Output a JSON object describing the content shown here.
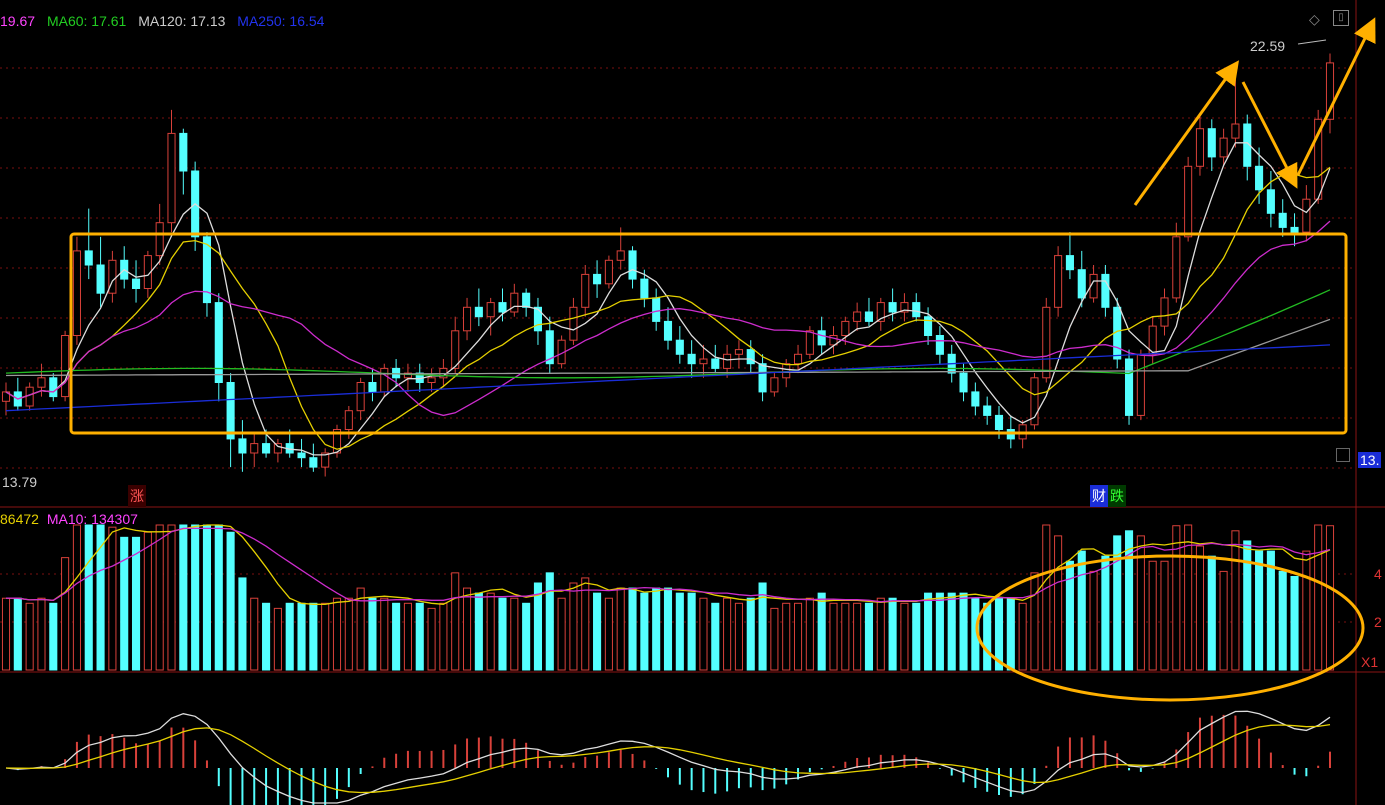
{
  "colors": {
    "up": "#d9413a",
    "down": "#54ffff",
    "white_line": "#dddddd",
    "yellow_line": "#e5d000",
    "magenta_line": "#cc2ccc",
    "green_line": "#22bb22",
    "gray_line": "#9a9a9a",
    "blue_line": "#1a2dd8",
    "grid": "#7a1010",
    "annotation": "#ffb000"
  },
  "price_header": {
    "items": [
      {
        "label": "19.67",
        "color": "#ff44ff"
      },
      {
        "label": "MA60: 17.61",
        "color": "#22cc22"
      },
      {
        "label": "MA120: 17.13",
        "color": "#cccccc"
      },
      {
        "label": "MA250: 16.54",
        "color": "#2233ee"
      }
    ]
  },
  "volume_header": {
    "items": [
      {
        "label": "86472",
        "color": "#e5d000"
      },
      {
        "label": "MA10: 134307",
        "color": "#ff44ff"
      }
    ]
  },
  "labels": {
    "low_price": "13.79",
    "high_price": "22.59",
    "marker_zhang": "涨",
    "marker_cai": "财",
    "marker_die": "跌",
    "right_price_tag": "13.",
    "vol_axis_4": "4",
    "vol_axis_2": "2",
    "vol_unit": "X1"
  },
  "icons": [
    "diamond-icon",
    "window-icon"
  ],
  "chart_data": [
    {
      "type": "candlestick",
      "description_source": "price panel",
      "ylim": [
        13.3,
        23.3
      ],
      "visible_values": {
        "high": 22.59,
        "low": 13.79
      },
      "series": [
        {
          "name": "MA60",
          "value_last": 17.61
        },
        {
          "name": "MA120",
          "value_last": 17.13
        },
        {
          "name": "MA250",
          "value_last": 16.54
        }
      ],
      "candles": [
        [
          15.4,
          15.8,
          15.1,
          15.6
        ],
        [
          15.6,
          15.9,
          15.2,
          15.3
        ],
        [
          15.3,
          15.8,
          15.2,
          15.7
        ],
        [
          15.7,
          16.2,
          15.5,
          15.9
        ],
        [
          15.9,
          16.0,
          15.4,
          15.5
        ],
        [
          15.5,
          16.9,
          15.4,
          16.8
        ],
        [
          16.8,
          18.9,
          16.6,
          18.6
        ],
        [
          18.6,
          19.5,
          18.0,
          18.3
        ],
        [
          18.3,
          18.9,
          17.4,
          17.7
        ],
        [
          17.7,
          18.6,
          17.5,
          18.4
        ],
        [
          18.4,
          18.7,
          17.8,
          18.0
        ],
        [
          18.0,
          18.4,
          17.5,
          17.8
        ],
        [
          17.8,
          18.6,
          17.6,
          18.5
        ],
        [
          18.5,
          19.6,
          18.3,
          19.2
        ],
        [
          19.2,
          21.6,
          19.0,
          21.1
        ],
        [
          21.1,
          21.2,
          19.8,
          20.3
        ],
        [
          20.3,
          20.5,
          18.6,
          18.9
        ],
        [
          18.9,
          19.0,
          17.2,
          17.5
        ],
        [
          17.5,
          17.7,
          15.4,
          15.8
        ],
        [
          15.8,
          16.0,
          14.0,
          14.6
        ],
        [
          14.6,
          15.0,
          13.9,
          14.3
        ],
        [
          14.3,
          14.7,
          14.0,
          14.5
        ],
        [
          14.5,
          14.8,
          14.2,
          14.3
        ],
        [
          14.3,
          14.6,
          14.1,
          14.5
        ],
        [
          14.5,
          14.8,
          14.2,
          14.3
        ],
        [
          14.3,
          14.6,
          14.0,
          14.2
        ],
        [
          14.2,
          14.5,
          13.9,
          14.0
        ],
        [
          14.0,
          14.4,
          13.8,
          14.3
        ],
        [
          14.3,
          14.9,
          14.2,
          14.8
        ],
        [
          14.8,
          15.3,
          14.6,
          15.2
        ],
        [
          15.2,
          15.9,
          15.0,
          15.8
        ],
        [
          15.8,
          16.1,
          15.4,
          15.6
        ],
        [
          15.6,
          16.2,
          15.5,
          16.1
        ],
        [
          16.1,
          16.3,
          15.7,
          15.9
        ],
        [
          15.9,
          16.2,
          15.6,
          16.0
        ],
        [
          16.0,
          16.2,
          15.6,
          15.8
        ],
        [
          15.8,
          16.1,
          15.6,
          15.9
        ],
        [
          15.9,
          16.3,
          15.7,
          16.1
        ],
        [
          16.1,
          17.2,
          16.0,
          16.9
        ],
        [
          16.9,
          17.6,
          16.7,
          17.4
        ],
        [
          17.4,
          17.8,
          17.0,
          17.2
        ],
        [
          17.2,
          17.6,
          16.8,
          17.5
        ],
        [
          17.5,
          17.8,
          17.1,
          17.3
        ],
        [
          17.3,
          17.9,
          17.2,
          17.7
        ],
        [
          17.7,
          17.8,
          17.2,
          17.4
        ],
        [
          17.4,
          17.6,
          16.6,
          16.9
        ],
        [
          16.9,
          17.2,
          16.0,
          16.2
        ],
        [
          16.2,
          16.8,
          16.1,
          16.7
        ],
        [
          16.7,
          17.6,
          16.6,
          17.4
        ],
        [
          17.4,
          18.3,
          17.2,
          18.1
        ],
        [
          18.1,
          18.4,
          17.6,
          17.9
        ],
        [
          17.9,
          18.5,
          17.8,
          18.4
        ],
        [
          18.4,
          19.1,
          18.2,
          18.6
        ],
        [
          18.6,
          18.7,
          17.8,
          18.0
        ],
        [
          18.0,
          18.2,
          17.4,
          17.6
        ],
        [
          17.6,
          17.8,
          16.9,
          17.1
        ],
        [
          17.1,
          17.4,
          16.5,
          16.7
        ],
        [
          16.7,
          17.0,
          16.2,
          16.4
        ],
        [
          16.4,
          16.7,
          15.9,
          16.2
        ],
        [
          16.2,
          16.6,
          15.9,
          16.3
        ],
        [
          16.3,
          16.6,
          16.0,
          16.1
        ],
        [
          16.1,
          16.6,
          15.9,
          16.4
        ],
        [
          16.4,
          16.7,
          16.1,
          16.5
        ],
        [
          16.5,
          16.7,
          16.0,
          16.2
        ],
        [
          16.2,
          16.4,
          15.4,
          15.6
        ],
        [
          15.6,
          16.0,
          15.5,
          15.9
        ],
        [
          15.9,
          16.3,
          15.7,
          16.2
        ],
        [
          16.2,
          16.6,
          16.0,
          16.4
        ],
        [
          16.4,
          17.0,
          16.3,
          16.9
        ],
        [
          16.9,
          17.2,
          16.4,
          16.6
        ],
        [
          16.6,
          17.0,
          16.4,
          16.8
        ],
        [
          16.8,
          17.2,
          16.6,
          17.1
        ],
        [
          17.1,
          17.5,
          16.9,
          17.3
        ],
        [
          17.3,
          17.6,
          17.0,
          17.1
        ],
        [
          17.1,
          17.6,
          16.9,
          17.5
        ],
        [
          17.5,
          17.8,
          17.1,
          17.3
        ],
        [
          17.3,
          17.7,
          17.1,
          17.5
        ],
        [
          17.5,
          17.7,
          17.1,
          17.2
        ],
        [
          17.2,
          17.4,
          16.6,
          16.8
        ],
        [
          16.8,
          17.0,
          16.2,
          16.4
        ],
        [
          16.4,
          16.6,
          15.8,
          16.0
        ],
        [
          16.0,
          16.2,
          15.4,
          15.6
        ],
        [
          15.6,
          15.8,
          15.1,
          15.3
        ],
        [
          15.3,
          15.5,
          14.9,
          15.1
        ],
        [
          15.1,
          15.3,
          14.6,
          14.8
        ],
        [
          14.8,
          15.1,
          14.4,
          14.6
        ],
        [
          14.6,
          15.0,
          14.4,
          14.9
        ],
        [
          14.9,
          16.0,
          14.8,
          15.9
        ],
        [
          15.9,
          17.6,
          15.8,
          17.4
        ],
        [
          17.4,
          18.7,
          17.2,
          18.5
        ],
        [
          18.5,
          19.0,
          18.0,
          18.2
        ],
        [
          18.2,
          18.6,
          17.4,
          17.6
        ],
        [
          17.6,
          18.3,
          17.5,
          18.1
        ],
        [
          18.1,
          18.3,
          17.2,
          17.4
        ],
        [
          17.4,
          17.6,
          16.1,
          16.3
        ],
        [
          16.3,
          16.5,
          14.9,
          15.1
        ],
        [
          15.1,
          16.5,
          15.0,
          16.4
        ],
        [
          16.4,
          17.2,
          16.2,
          17.0
        ],
        [
          17.0,
          17.8,
          16.8,
          17.6
        ],
        [
          17.6,
          19.2,
          17.5,
          18.9
        ],
        [
          18.9,
          20.6,
          18.8,
          20.4
        ],
        [
          20.4,
          21.5,
          20.2,
          21.2
        ],
        [
          21.2,
          21.4,
          20.3,
          20.6
        ],
        [
          20.6,
          21.2,
          20.4,
          21.0
        ],
        [
          21.0,
          22.4,
          20.8,
          21.3
        ],
        [
          21.3,
          21.5,
          20.1,
          20.4
        ],
        [
          20.4,
          20.8,
          19.6,
          19.9
        ],
        [
          19.9,
          20.3,
          19.1,
          19.4
        ],
        [
          19.4,
          19.7,
          18.9,
          19.1
        ],
        [
          19.1,
          19.4,
          18.7,
          19.0
        ],
        [
          19.0,
          20.0,
          18.8,
          19.7
        ],
        [
          19.7,
          21.6,
          19.6,
          21.4
        ],
        [
          21.4,
          22.8,
          21.1,
          22.6
        ]
      ]
    },
    {
      "type": "bar",
      "description_source": "volume panel",
      "series": [
        {
          "name": "MA10",
          "value_last": 134307
        }
      ],
      "value_label": 86472
    },
    {
      "type": "bar",
      "description_source": "MACD-style oscillator panel (unlabeled)"
    }
  ]
}
